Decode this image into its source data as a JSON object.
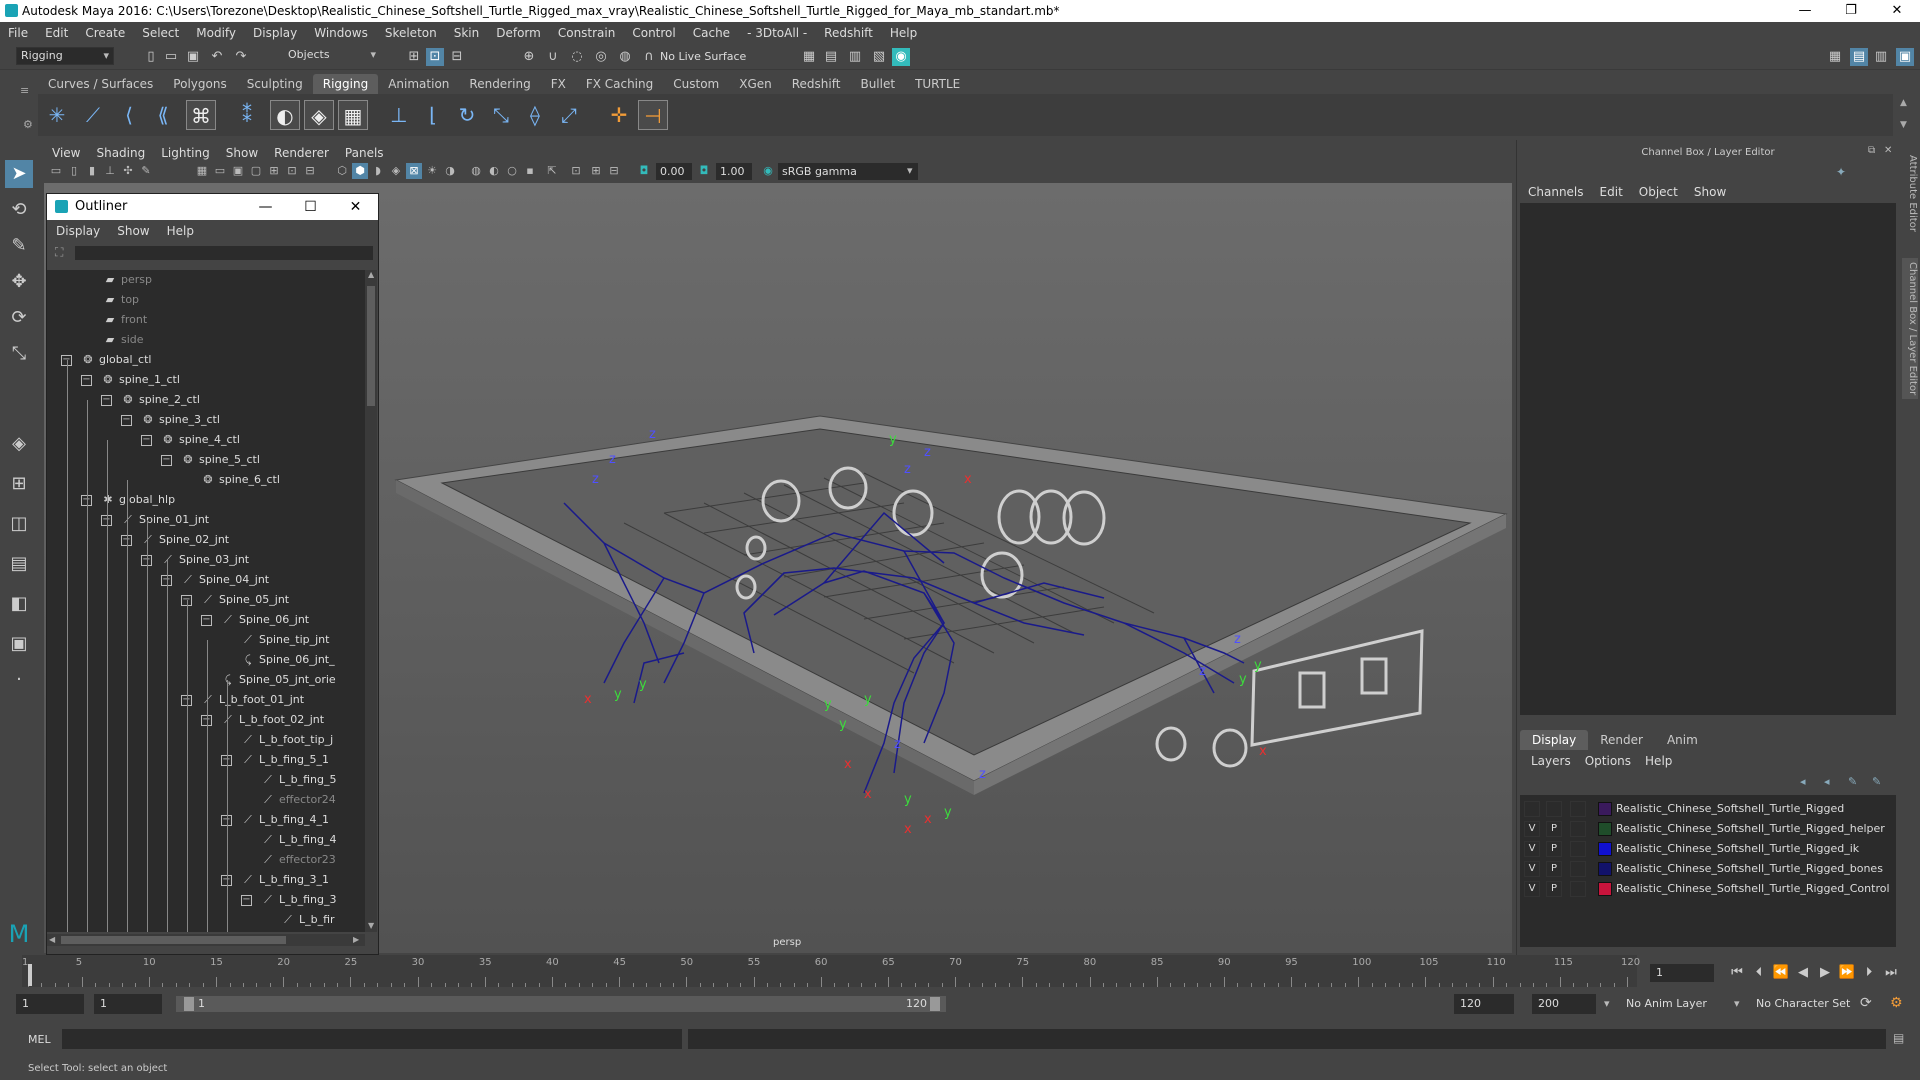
{
  "window": {
    "title": "Autodesk Maya 2016: C:\\Users\\Torezone\\Desktop\\Realistic_Chinese_Softshell_Turtle_Rigged_max_vray\\Realistic_Chinese_Softshell_Turtle_Rigged_for_Maya_mb_standart.mb*",
    "minimize": "—",
    "restore": "❐",
    "close": "✕"
  },
  "menubar": [
    "File",
    "Edit",
    "Create",
    "Select",
    "Modify",
    "Display",
    "Windows",
    "Skeleton",
    "Skin",
    "Deform",
    "Constrain",
    "Control",
    "Cache",
    "- 3DtoAll -",
    "Redshift",
    "Help"
  ],
  "statusline": {
    "menuset": "Rigging",
    "selection_mode": "Objects",
    "live_surface": "No Live Surface"
  },
  "shelf_tabs": [
    "Curves / Surfaces",
    "Polygons",
    "Sculpting",
    "Rigging",
    "Animation",
    "Rendering",
    "FX",
    "FX Caching",
    "Custom",
    "XGen",
    "Redshift",
    "Bullet",
    "TURTLE"
  ],
  "shelf_active": "Rigging",
  "viewport": {
    "menu": [
      "View",
      "Shading",
      "Lighting",
      "Show",
      "Renderer",
      "Panels"
    ],
    "near_value": "0.00",
    "far_value": "1.00",
    "color_space": "sRGB gamma",
    "camera_label": "persp"
  },
  "outliner": {
    "title": "Outliner",
    "menu": [
      "Display",
      "Show",
      "Help"
    ],
    "rows": [
      {
        "label": "persp",
        "depth": 0,
        "icon": "camera-icon",
        "dim": true,
        "expand": ""
      },
      {
        "label": "top",
        "depth": 0,
        "icon": "camera-icon",
        "dim": true,
        "expand": ""
      },
      {
        "label": "front",
        "depth": 0,
        "icon": "camera-icon",
        "dim": true,
        "expand": ""
      },
      {
        "label": "side",
        "depth": 0,
        "icon": "camera-icon",
        "dim": true,
        "expand": ""
      },
      {
        "label": "global_ctl",
        "depth": 0,
        "icon": "curve-icon",
        "dim": false,
        "expand": "−"
      },
      {
        "label": "spine_1_ctl",
        "depth": 1,
        "icon": "curve-icon",
        "dim": false,
        "expand": "−"
      },
      {
        "label": "spine_2_ctl",
        "depth": 2,
        "icon": "curve-icon",
        "dim": false,
        "expand": "−"
      },
      {
        "label": "spine_3_ctl",
        "depth": 3,
        "icon": "curve-icon",
        "dim": false,
        "expand": "−"
      },
      {
        "label": "spine_4_ctl",
        "depth": 4,
        "icon": "curve-icon",
        "dim": false,
        "expand": "−"
      },
      {
        "label": "spine_5_ctl",
        "depth": 5,
        "icon": "curve-icon",
        "dim": false,
        "expand": "−"
      },
      {
        "label": "spine_6_ctl",
        "depth": 6,
        "icon": "curve-icon",
        "dim": false,
        "expand": ""
      },
      {
        "label": "global_hlp",
        "depth": 1,
        "icon": "locator-icon",
        "dim": false,
        "expand": "−"
      },
      {
        "label": "Spine_01_jnt",
        "depth": 2,
        "icon": "joint-icon",
        "dim": false,
        "expand": "−"
      },
      {
        "label": "Spine_02_jnt",
        "depth": 3,
        "icon": "joint-icon",
        "dim": false,
        "expand": "−"
      },
      {
        "label": "Spine_03_jnt",
        "depth": 4,
        "icon": "joint-icon",
        "dim": false,
        "expand": "−"
      },
      {
        "label": "Spine_04_jnt",
        "depth": 5,
        "icon": "joint-icon",
        "dim": false,
        "expand": "−"
      },
      {
        "label": "Spine_05_jnt",
        "depth": 6,
        "icon": "joint-icon",
        "dim": false,
        "expand": "−"
      },
      {
        "label": "Spine_06_jnt",
        "depth": 7,
        "icon": "joint-icon",
        "dim": false,
        "expand": "−"
      },
      {
        "label": "Spine_tip_jnt",
        "depth": 8,
        "icon": "joint-icon",
        "dim": false,
        "expand": ""
      },
      {
        "label": "Spine_06_jnt_",
        "depth": 8,
        "icon": "constraint-icon",
        "dim": false,
        "expand": ""
      },
      {
        "label": "Spine_05_jnt_orie",
        "depth": 7,
        "icon": "constraint-icon",
        "dim": false,
        "expand": ""
      },
      {
        "label": "L_b_foot_01_jnt",
        "depth": 6,
        "icon": "joint-icon",
        "dim": false,
        "expand": "−"
      },
      {
        "label": "L_b_foot_02_jnt",
        "depth": 7,
        "icon": "joint-icon",
        "dim": false,
        "expand": "−"
      },
      {
        "label": "L_b_foot_tip_j",
        "depth": 8,
        "icon": "joint-icon",
        "dim": false,
        "expand": ""
      },
      {
        "label": "L_b_fing_5_1",
        "depth": 8,
        "icon": "joint-icon",
        "dim": false,
        "expand": "−"
      },
      {
        "label": "L_b_fing_5",
        "depth": 9,
        "icon": "joint-icon",
        "dim": false,
        "expand": ""
      },
      {
        "label": "effector24",
        "depth": 9,
        "icon": "effector-icon",
        "dim": true,
        "expand": ""
      },
      {
        "label": "L_b_fing_4_1",
        "depth": 8,
        "icon": "joint-icon",
        "dim": false,
        "expand": "−"
      },
      {
        "label": "L_b_fing_4",
        "depth": 9,
        "icon": "joint-icon",
        "dim": false,
        "expand": ""
      },
      {
        "label": "effector23",
        "depth": 9,
        "icon": "effector-icon",
        "dim": true,
        "expand": ""
      },
      {
        "label": "L_b_fing_3_1",
        "depth": 8,
        "icon": "joint-icon",
        "dim": false,
        "expand": "−"
      },
      {
        "label": "L_b_fing_3",
        "depth": 9,
        "icon": "joint-icon",
        "dim": false,
        "expand": "−"
      },
      {
        "label": "L_b_fir",
        "depth": 10,
        "icon": "joint-icon",
        "dim": false,
        "expand": ""
      }
    ]
  },
  "channel_box": {
    "title": "Channel Box / Layer Editor",
    "menu": [
      "Channels",
      "Edit",
      "Object",
      "Show"
    ]
  },
  "layer_editor": {
    "tabs": [
      "Display",
      "Render",
      "Anim"
    ],
    "active_tab": "Display",
    "menu": [
      "Layers",
      "Options",
      "Help"
    ],
    "layers": [
      {
        "v": "",
        "p": "",
        "color": "#3a1a5c",
        "name": "Realistic_Chinese_Softshell_Turtle_Rigged"
      },
      {
        "v": "V",
        "p": "P",
        "color": "#1f4d2a",
        "name": "Realistic_Chinese_Softshell_Turtle_Rigged_helper"
      },
      {
        "v": "V",
        "p": "P",
        "color": "#1010d0",
        "name": "Realistic_Chinese_Softshell_Turtle_Rigged_ik"
      },
      {
        "v": "V",
        "p": "P",
        "color": "#12126a",
        "name": "Realistic_Chinese_Softshell_Turtle_Rigged_bones"
      },
      {
        "v": "V",
        "p": "P",
        "color": "#c8143c",
        "name": "Realistic_Chinese_Softshell_Turtle_Rigged_Control"
      }
    ]
  },
  "side_tabs": {
    "attribute_editor": "Attribute Editor",
    "channel_box": "Channel Box / Layer Editor"
  },
  "timeslider": {
    "labels": [
      "1",
      "5",
      "10",
      "15",
      "20",
      "25",
      "30",
      "35",
      "40",
      "45",
      "50",
      "55",
      "60",
      "65",
      "70",
      "75",
      "80",
      "85",
      "90",
      "95",
      "100",
      "105",
      "110",
      "115",
      "120"
    ],
    "current_frame": "1"
  },
  "range": {
    "start": "1",
    "playback_start": "1",
    "slider_start": "1",
    "slider_end": "120",
    "playback_end": "120",
    "end": "200",
    "anim_layer": "No Anim Layer",
    "character_set": "No Character Set"
  },
  "command_line": {
    "label": "MEL"
  },
  "help_line": "Select Tool: select an object"
}
